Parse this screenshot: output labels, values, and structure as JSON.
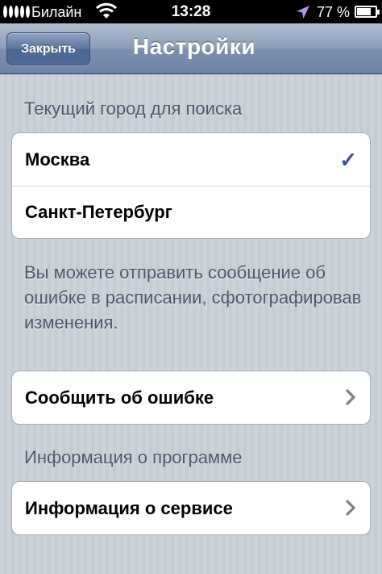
{
  "status_bar": {
    "carrier": "Билайн",
    "time": "13:28",
    "battery_percent": "77 %",
    "battery_level": 0.77,
    "icons": [
      "signal-icon",
      "wifi-icon",
      "location-icon",
      "battery-icon"
    ]
  },
  "nav_bar": {
    "close_label": "Закрыть",
    "title": "Настройки"
  },
  "city_section": {
    "header": "Текущий город для поиска",
    "items": [
      {
        "label": "Москва",
        "selected": true
      },
      {
        "label": "Санкт-Петербург",
        "selected": false
      }
    ],
    "checkmark": "✓"
  },
  "report_section": {
    "description": "Вы можете отправить сообщение об ошибке в расписании, сфотографировав изменения.",
    "button_label": "Сообщить об ошибке"
  },
  "info_section": {
    "header": "Информация о программе",
    "button_label": "Информация о сервисе"
  },
  "colors": {
    "accent_check": "#385487",
    "nav_bar": "#6d85a5",
    "background": "#c5ccd4"
  }
}
